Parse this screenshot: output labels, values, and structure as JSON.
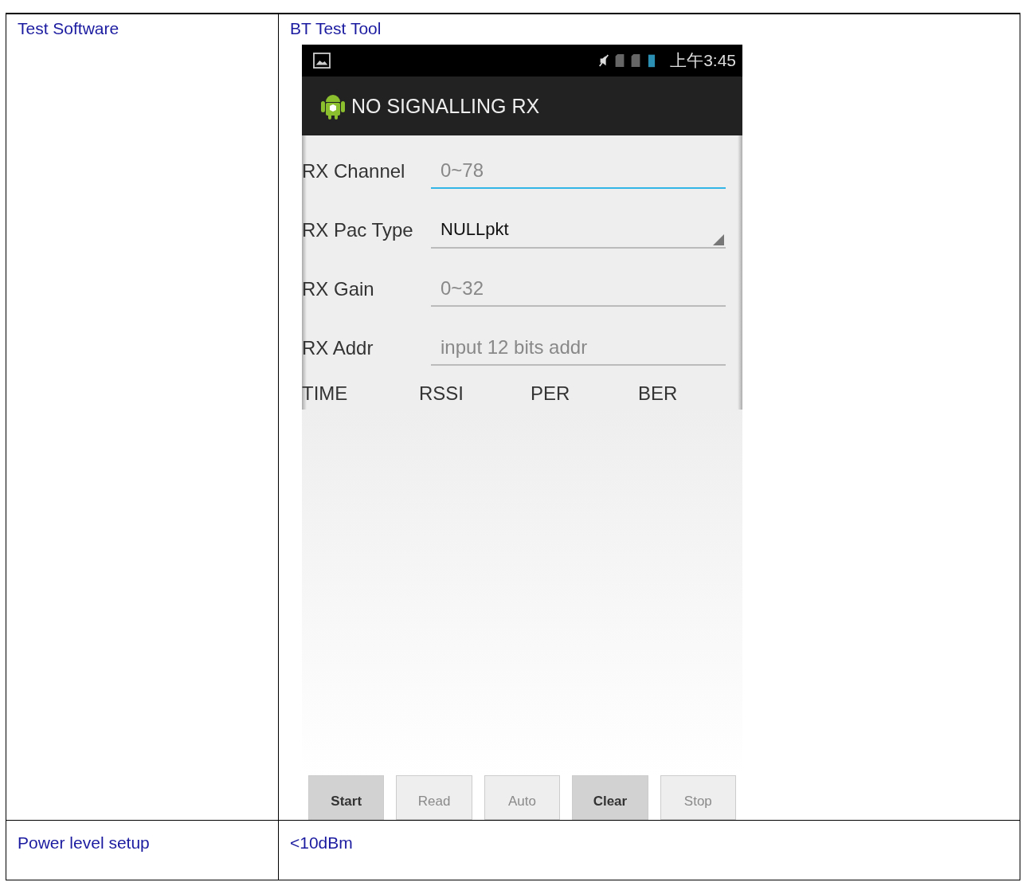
{
  "table": {
    "rows": [
      {
        "label": "Test Software",
        "value": "BT Test Tool",
        "phone": {
          "status_bar": {
            "time": "上午3:45"
          },
          "action_bar": {
            "title": "NO SIGNALLING RX"
          },
          "fields": [
            {
              "kind": "input",
              "label": "RX Channel",
              "placeholder": "0~78",
              "focused": true
            },
            {
              "kind": "spinner",
              "label": "RX Pac Type",
              "value": "NULLpkt"
            },
            {
              "kind": "input",
              "label": "RX Gain",
              "placeholder": "0~32",
              "focused": false
            },
            {
              "kind": "input",
              "label": "RX Addr",
              "placeholder": "input 12 bits addr",
              "focused": false
            }
          ],
          "columns": [
            "TIME",
            "RSSI",
            "PER",
            "BER"
          ],
          "buttons": [
            {
              "label": "Start",
              "disabled": false
            },
            {
              "label": "Read",
              "disabled": true
            },
            {
              "label": "Auto",
              "disabled": true
            },
            {
              "label": "Clear",
              "disabled": false
            },
            {
              "label": "Stop",
              "disabled": true
            }
          ]
        }
      },
      {
        "label": "Power level setup",
        "value": "<10dBm"
      }
    ]
  }
}
